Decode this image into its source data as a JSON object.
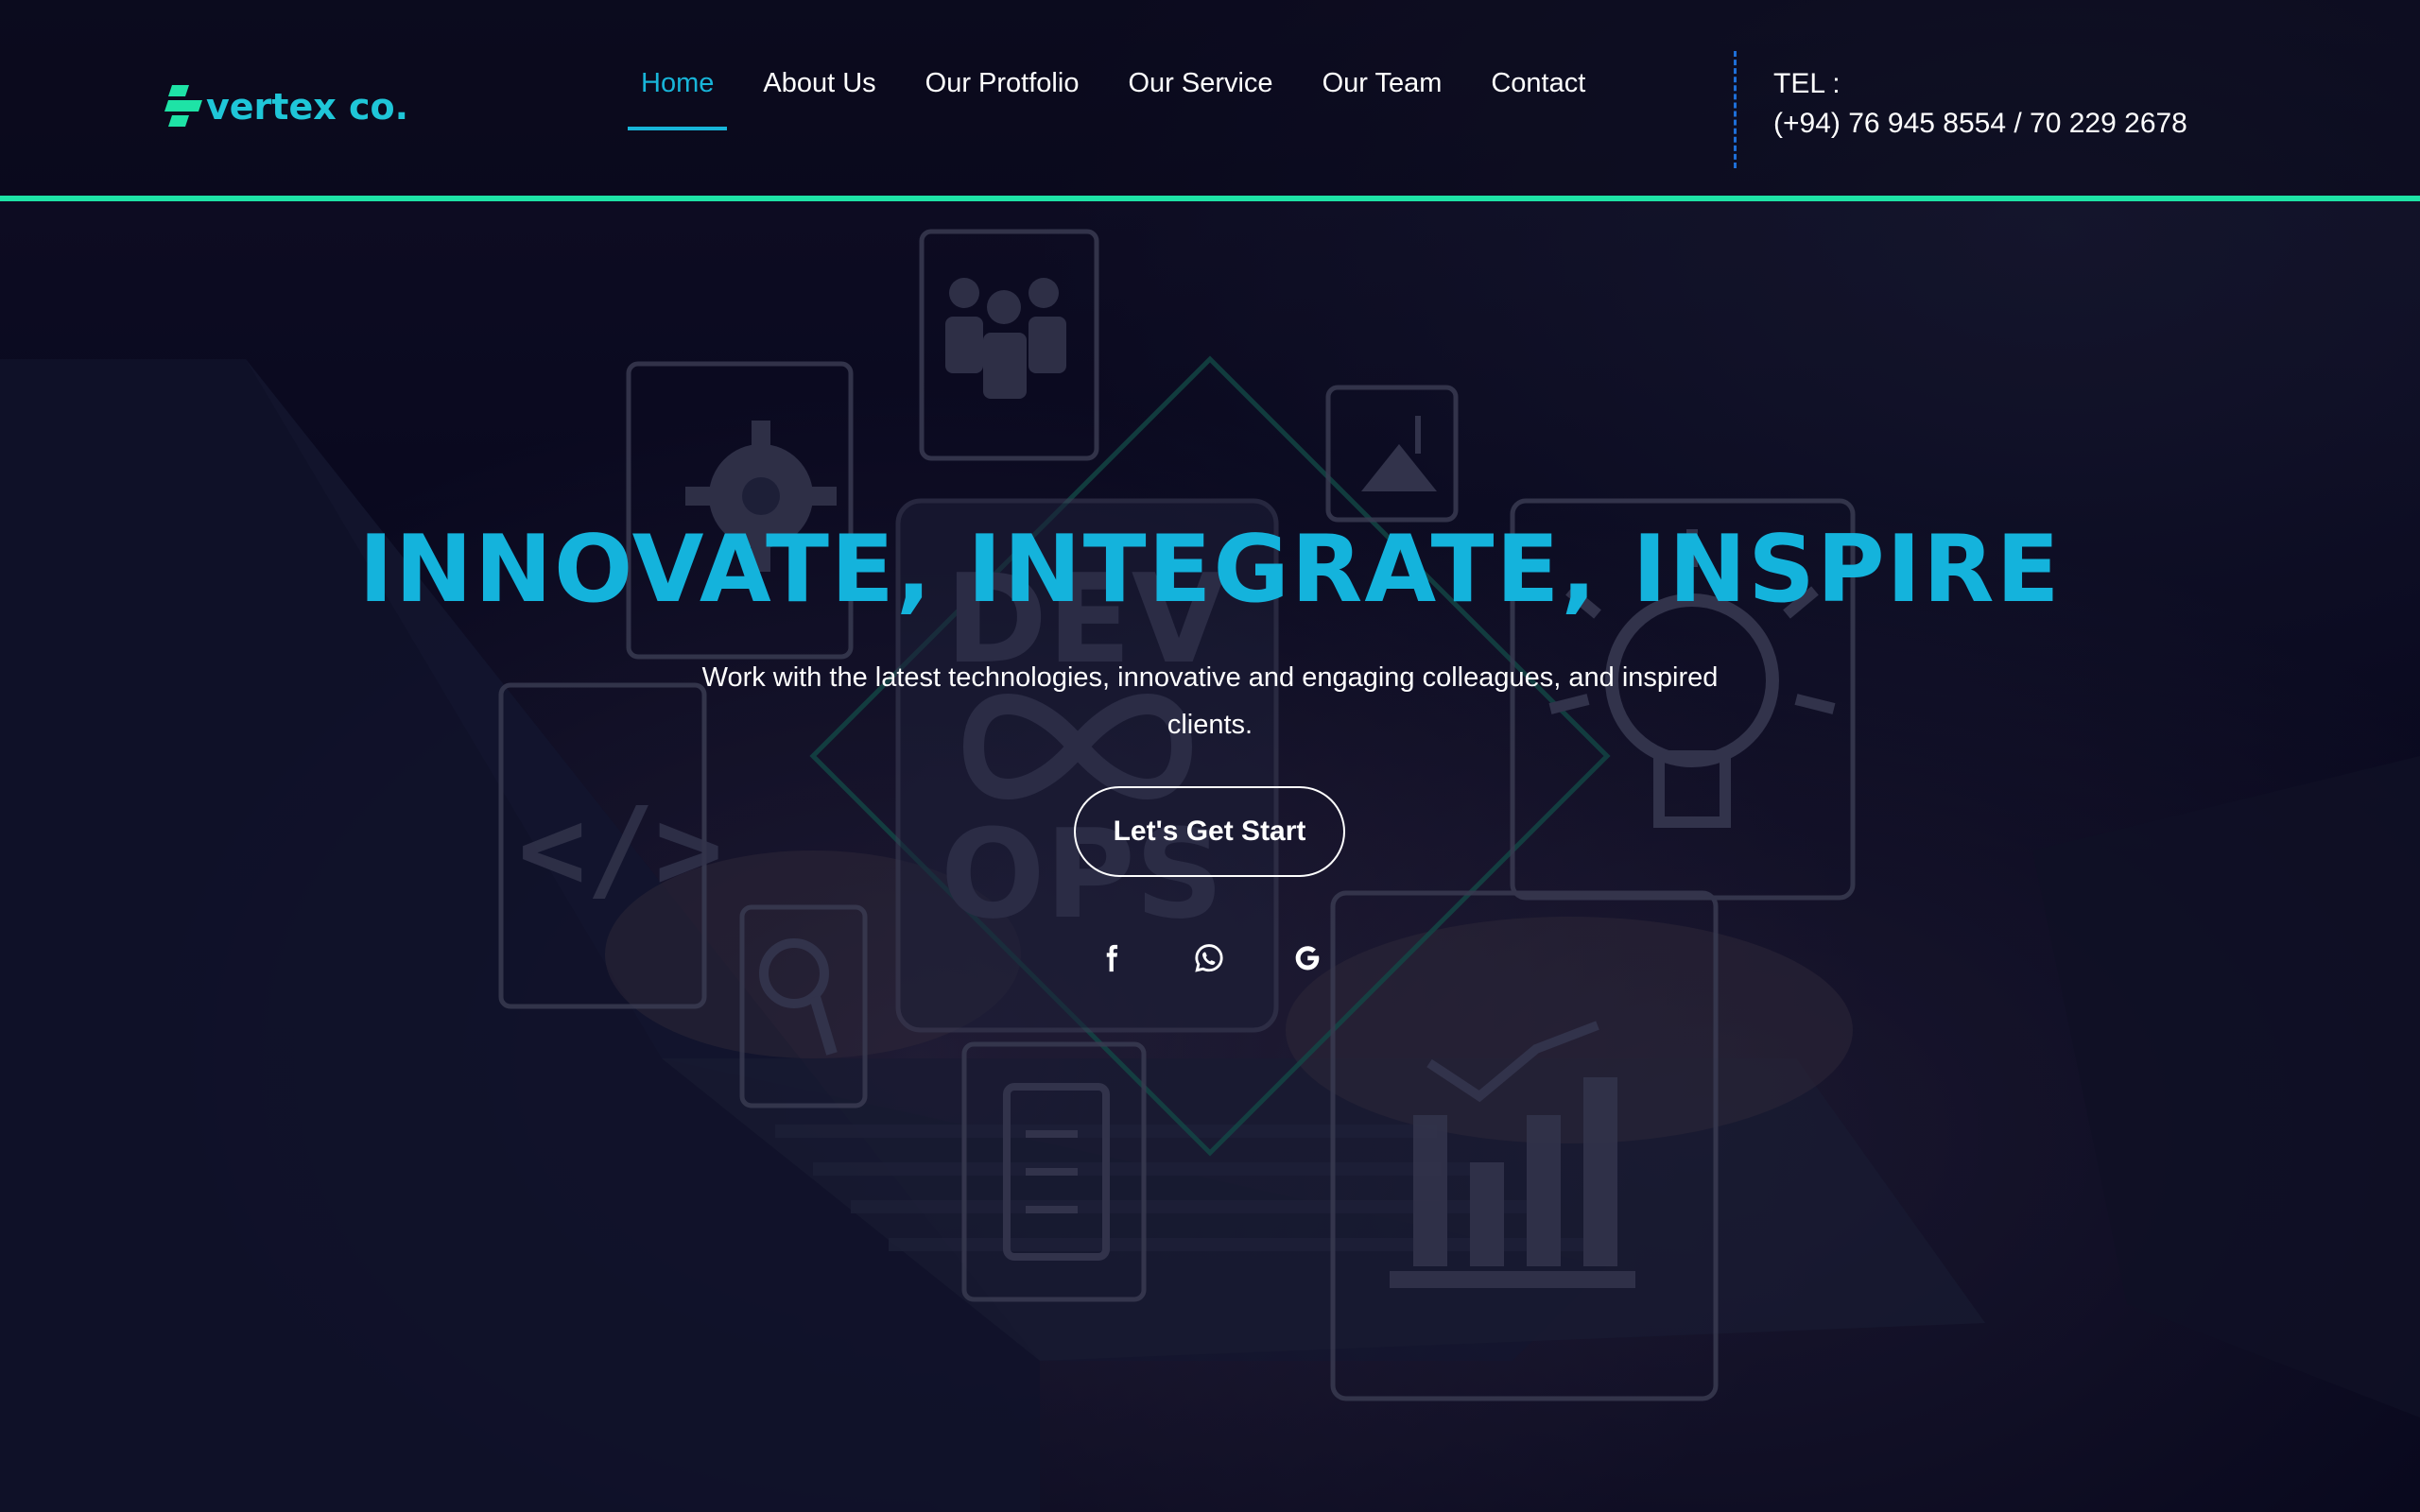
{
  "brand": {
    "name": "vertex co.",
    "accent_color": "#1ee3a6",
    "title_color": "#14b3dc"
  },
  "nav": {
    "items": [
      {
        "label": "Home",
        "active": true
      },
      {
        "label": "About Us",
        "active": false
      },
      {
        "label": "Our Protfolio",
        "active": false
      },
      {
        "label": "Our Service",
        "active": false
      },
      {
        "label": "Our Team",
        "active": false
      },
      {
        "label": "Contact",
        "active": false
      }
    ]
  },
  "contact": {
    "tel_label": "TEL :",
    "tel_numbers": "(+94) 76 945 8554 / 70 229 2678"
  },
  "hero": {
    "title": "INNOVATE, INTEGRATE, INSPIRE",
    "subtitle": "Work with the latest technologies, innovative and engaging colleagues, and inspired clients.",
    "cta_label": "Let's Get Start",
    "background_words": [
      "DEV",
      "OPS"
    ]
  },
  "social": {
    "icons": [
      "facebook-icon",
      "whatsapp-icon",
      "google-icon"
    ]
  }
}
